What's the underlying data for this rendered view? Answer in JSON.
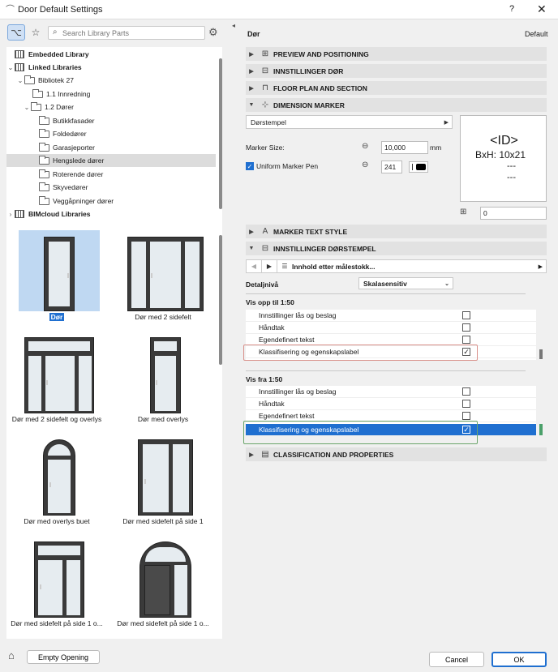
{
  "window": {
    "title": "Door Default Settings",
    "help": "?",
    "close": "✕"
  },
  "left": {
    "search_placeholder": "Search Library Parts",
    "tree": [
      {
        "label": "Embedded Library",
        "bold": true
      },
      {
        "label": "Linked Libraries",
        "bold": true
      },
      {
        "label": "Bibliotek 27"
      },
      {
        "label": "1.1 Innredning"
      },
      {
        "label": "1.2 Dører"
      },
      {
        "label": "Butikkfasader"
      },
      {
        "label": "Foldedører"
      },
      {
        "label": "Garasjeporter"
      },
      {
        "label": "Hengslede dører",
        "selected": true
      },
      {
        "label": "Roterende dører"
      },
      {
        "label": "Skyvedører"
      },
      {
        "label": "Veggåpninger dører"
      },
      {
        "label": "BIMcloud Libraries",
        "bold": true
      }
    ],
    "parts": [
      {
        "label": "Dør",
        "selected": true
      },
      {
        "label": "Dør med 2 sidefelt"
      },
      {
        "label": "Dør med 2 sidefelt og overlys"
      },
      {
        "label": "Dør med overlys"
      },
      {
        "label": "Dør med overlys buet"
      },
      {
        "label": "Dør med sidefelt på side 1"
      },
      {
        "label": "Dør med sidefelt på side 1 o..."
      },
      {
        "label": "Dør med sidefelt på side 1 o..."
      }
    ],
    "empty_opening": "Empty Opening"
  },
  "right": {
    "title": "Dør",
    "default_label": "Default",
    "sections": {
      "preview": "PREVIEW AND POSITIONING",
      "innstillinger_dor": "INNSTILLINGER DØR",
      "floor_plan": "FLOOR PLAN AND SECTION",
      "dimension_marker": "DIMENSION MARKER",
      "marker_text": "MARKER TEXT STYLE",
      "dorstempel": "INNSTILLINGER DØRSTEMPEL",
      "classification": "CLASSIFICATION AND PROPERTIES"
    },
    "marker_type": "Dørstempel",
    "marker_size_label": "Marker Size:",
    "marker_size": "10,000",
    "marker_unit": "mm",
    "uniform_pen_label": "Uniform Marker Pen",
    "pen_number": "241",
    "preview_id": "<ID>",
    "preview_bxh": "BxH:   10x21",
    "preview_dash": "---",
    "offset_value": "0",
    "nav_label": "Innhold etter målestokk...",
    "detail_label": "Detaljnivå",
    "detail_value": "Skalasensitiv",
    "group1_title": "Vis opp til 1:50",
    "group2_title": "Vis fra 1:50",
    "group1_items": [
      {
        "label": "Innstillinger lås og beslag",
        "checked": false
      },
      {
        "label": "Håndtak",
        "checked": false
      },
      {
        "label": "Egendefinert tekst",
        "checked": false
      },
      {
        "label": "Klassifisering og egenskapslabel",
        "checked": true
      }
    ],
    "group2_items": [
      {
        "label": "Innstillinger lås og beslag",
        "checked": false
      },
      {
        "label": "Håndtak",
        "checked": false
      },
      {
        "label": "Egendefinert tekst",
        "checked": false
      },
      {
        "label": "Klassifisering og egenskapslabel",
        "checked": true,
        "selected": true
      }
    ],
    "cancel": "Cancel",
    "ok": "OK"
  },
  "colors": {
    "accent": "#1f6fd0",
    "section_bg": "#e2e2e2",
    "red_outline": "#d9908a",
    "green_outline": "#6aa66a"
  }
}
